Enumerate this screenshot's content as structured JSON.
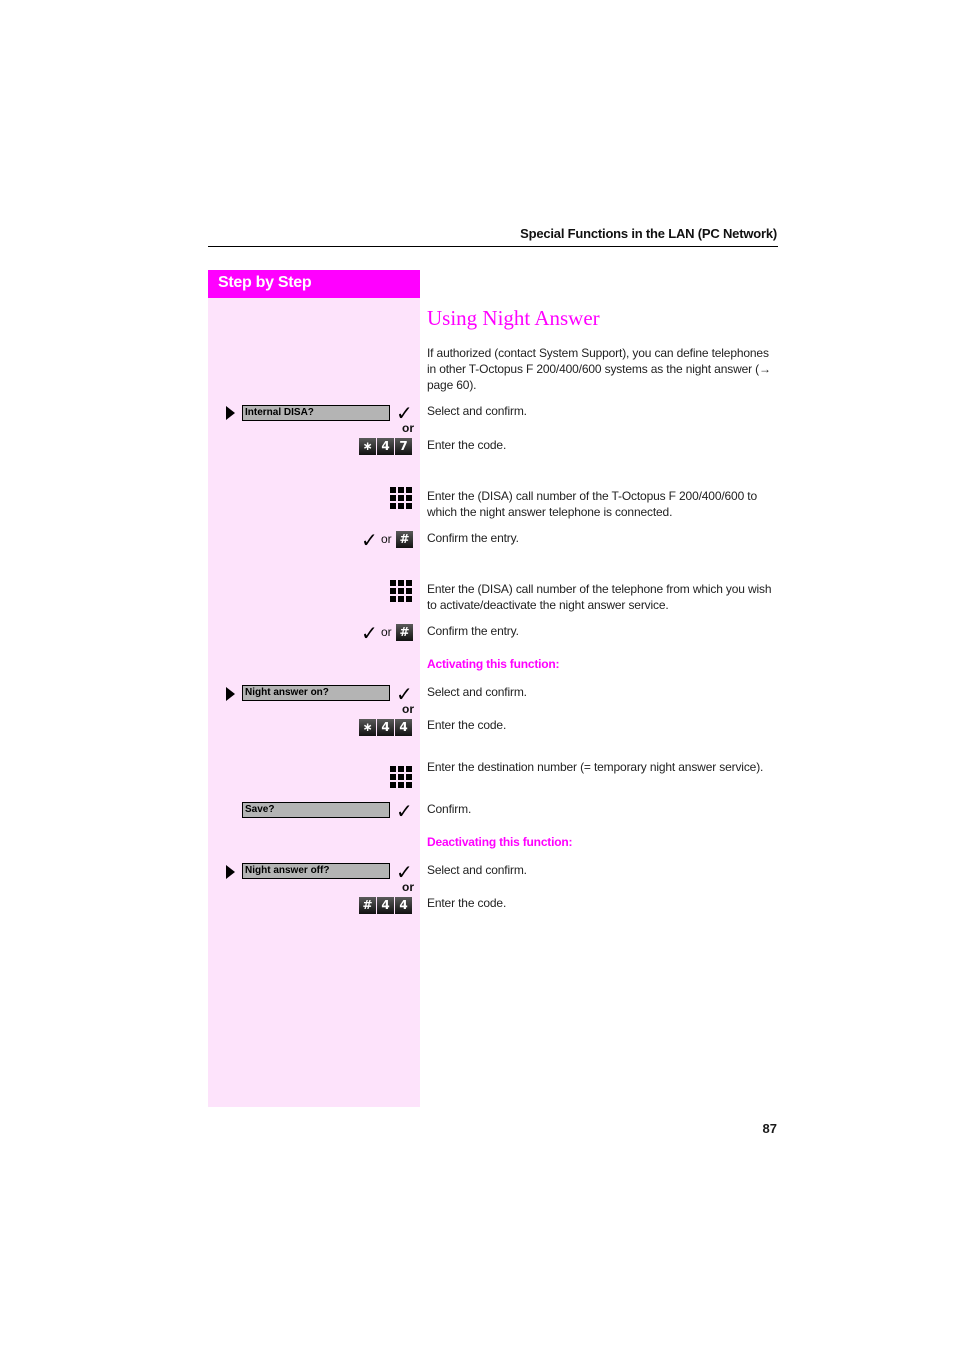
{
  "header": {
    "title": "Special Functions in the LAN (PC Network)"
  },
  "sidebar": {
    "title": "Step by Step"
  },
  "page_title": "Using Night Answer",
  "intro": "If authorized (contact System Support), you can define telephones in other T-Octopus F 200/400/600 systems as the night answer (→ page 60).",
  "steps": {
    "internal_disa": {
      "display": "Internal DISA?",
      "or": "or",
      "keys": [
        "∗",
        "4",
        "7"
      ],
      "text_select": "Select and confirm.",
      "text_code": "Enter the code."
    },
    "disa_number_1": {
      "text": "Enter the (DISA) call number of the T-Octopus F 200/400/600 to which the night answer telephone is connected."
    },
    "confirm_1": {
      "or": "or",
      "hash": "#",
      "text": "Confirm the entry."
    },
    "disa_number_2": {
      "text": "Enter the (DISA) call number of the telephone from which you wish to activate/deactivate the night answer service."
    },
    "confirm_2": {
      "or": "or",
      "hash": "#",
      "text": "Confirm the entry."
    }
  },
  "activating": {
    "heading": "Activating this function:",
    "display": "Night answer on?",
    "or": "or",
    "keys": [
      "∗",
      "4",
      "4"
    ],
    "text_select": "Select and confirm.",
    "text_code": "Enter the code.",
    "text_destination": "Enter the destination number (= temporary night answer service).",
    "save_display": "Save?",
    "text_confirm": "Confirm."
  },
  "deactivating": {
    "heading": "Deactivating this function:",
    "display": "Night answer off?",
    "or": "or",
    "keys": [
      "#",
      "4",
      "4"
    ],
    "text_select": "Select and confirm.",
    "text_code": "Enter the code."
  },
  "check_glyph": "✓",
  "page_number": "87"
}
